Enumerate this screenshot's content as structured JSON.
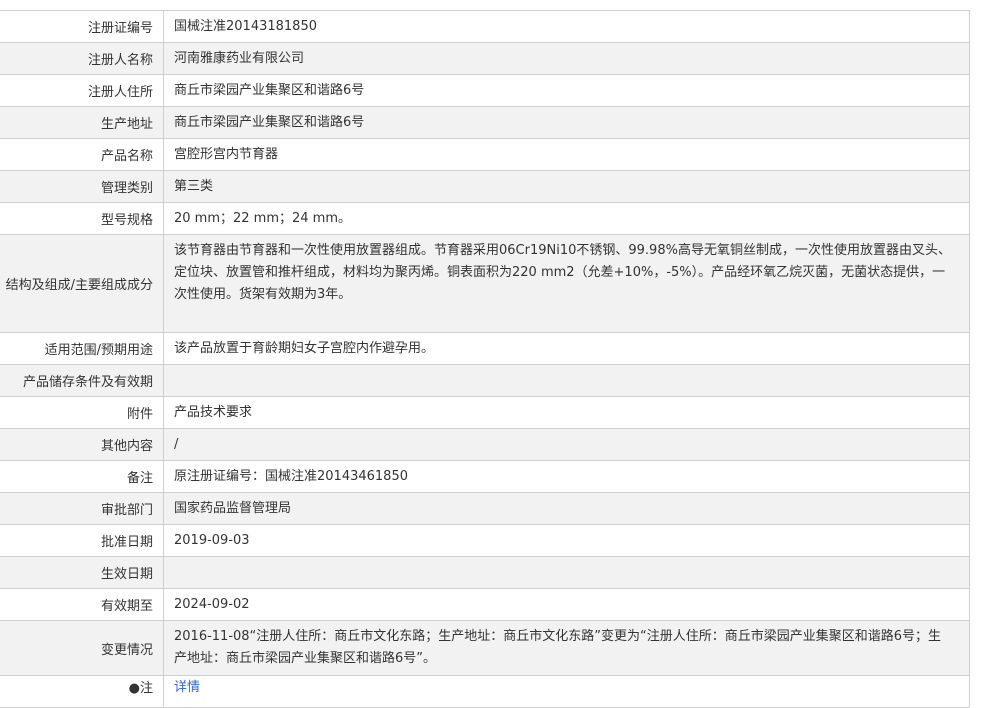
{
  "rows": [
    {
      "label": "注册证编号",
      "value": "国械注准20143181850"
    },
    {
      "label": "注册人名称",
      "value": "河南雅康药业有限公司"
    },
    {
      "label": "注册人住所",
      "value": "商丘市梁园产业集聚区和谐路6号"
    },
    {
      "label": "生产地址",
      "value": "商丘市梁园产业集聚区和谐路6号"
    },
    {
      "label": "产品名称",
      "value": "宫腔形宫内节育器"
    },
    {
      "label": "管理类别",
      "value": "第三类"
    },
    {
      "label": "型号规格",
      "value": "20 mm；22 mm；24 mm。"
    },
    {
      "label": "结构及组成/主要组成成分",
      "value": "该节育器由节育器和一次性使用放置器组成。节育器采用06Cr19Ni10不锈钢、99.98%高导无氧铜丝制成，一次性使用放置器由叉头、定位块、放置管和推杆组成，材料均为聚丙烯。铜表面积为220 mm2（允差+10%，-5%）。产品经环氧乙烷灭菌，无菌状态提供，一次性使用。货架有效期为3年。"
    },
    {
      "label": "适用范围/预期用途",
      "value": "该产品放置于育龄期妇女子宫腔内作避孕用。"
    },
    {
      "label": "产品储存条件及有效期",
      "value": ""
    },
    {
      "label": "附件",
      "value": "产品技术要求"
    },
    {
      "label": "其他内容",
      "value": "/"
    },
    {
      "label": "备注",
      "value": "原注册证编号：国械注准20143461850"
    },
    {
      "label": "审批部门",
      "value": "国家药品监督管理局"
    },
    {
      "label": "批准日期",
      "value": "2019-09-03"
    },
    {
      "label": "生效日期",
      "value": ""
    },
    {
      "label": "有效期至",
      "value": "2024-09-02"
    },
    {
      "label": "变更情况",
      "value": "2016-11-08“注册人住所：商丘市文化东路；生产地址：商丘市文化东路”变更为“注册人住所：商丘市梁园产业集聚区和谐路6号；生产地址：商丘市梁园产业集聚区和谐路6号”。"
    },
    {
      "label": "●注",
      "value": "详情"
    }
  ]
}
